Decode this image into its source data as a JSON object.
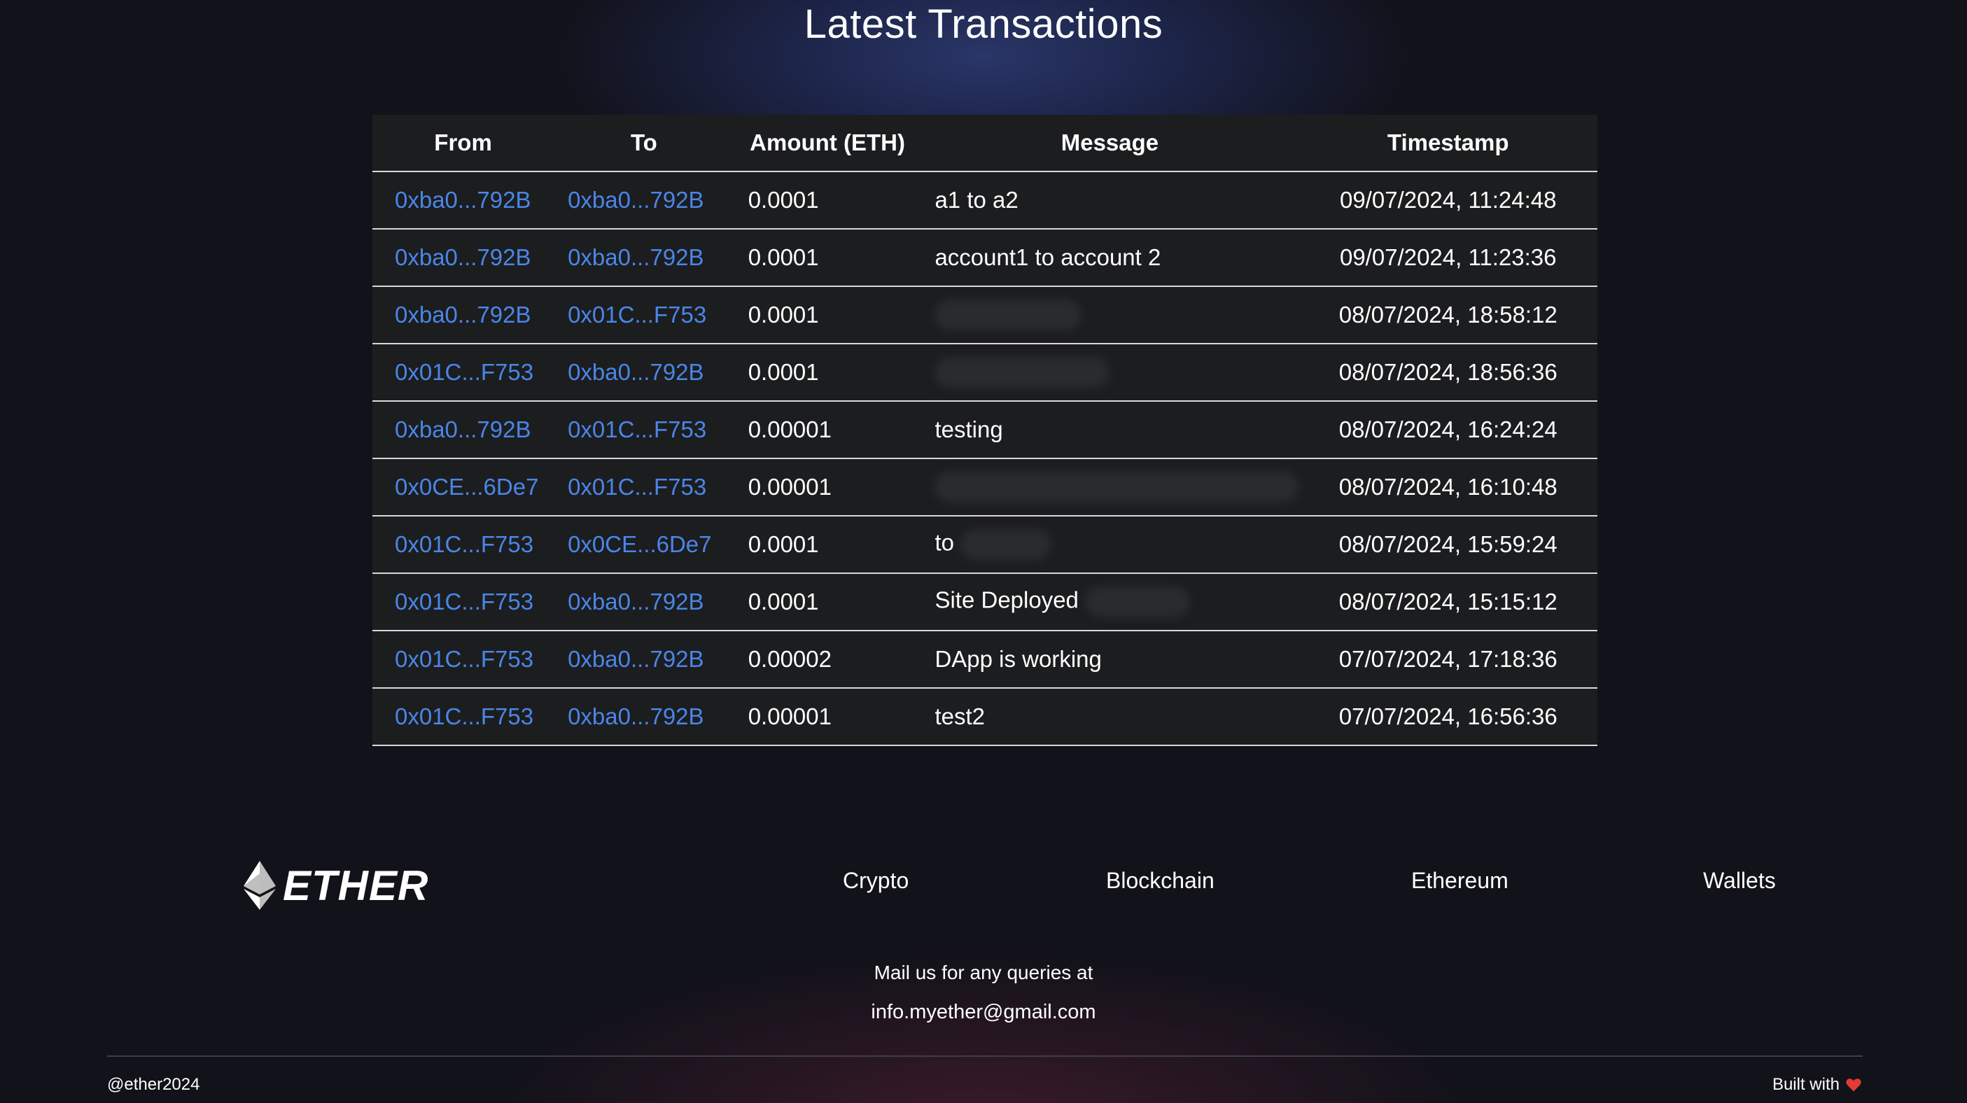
{
  "page": {
    "title": "Latest Transactions"
  },
  "table": {
    "headers": [
      "From",
      "To",
      "Amount (ETH)",
      "Message",
      "Timestamp"
    ],
    "rows": [
      {
        "from": "0xba0...792B",
        "to": "0xba0...792B",
        "amount": "0.0001",
        "message": "a1 to a2",
        "timestamp": "09/07/2024, 11:24:48"
      },
      {
        "from": "0xba0...792B",
        "to": "0xba0...792B",
        "amount": "0.0001",
        "message": "account1 to account 2",
        "timestamp": "09/07/2024, 11:23:36"
      },
      {
        "from": "0xba0...792B",
        "to": "0x01C...F753",
        "amount": "0.0001",
        "message": "",
        "timestamp": "08/07/2024, 18:58:12"
      },
      {
        "from": "0x01C...F753",
        "to": "0xba0...792B",
        "amount": "0.0001",
        "message": "",
        "timestamp": "08/07/2024, 18:56:36"
      },
      {
        "from": "0xba0...792B",
        "to": "0x01C...F753",
        "amount": "0.00001",
        "message": "testing",
        "timestamp": "08/07/2024, 16:24:24"
      },
      {
        "from": "0x0CE...6De7",
        "to": "0x01C...F753",
        "amount": "0.00001",
        "message": "",
        "timestamp": "08/07/2024, 16:10:48"
      },
      {
        "from": "0x01C...F753",
        "to": "0x0CE...6De7",
        "amount": "0.0001",
        "message": "to",
        "timestamp": "08/07/2024, 15:59:24"
      },
      {
        "from": "0x01C...F753",
        "to": "0xba0...792B",
        "amount": "0.0001",
        "message": "Site Deployed",
        "timestamp": "08/07/2024, 15:15:12"
      },
      {
        "from": "0x01C...F753",
        "to": "0xba0...792B",
        "amount": "0.00002",
        "message": "DApp is working",
        "timestamp": "07/07/2024, 17:18:36"
      },
      {
        "from": "0x01C...F753",
        "to": "0xba0...792B",
        "amount": "0.00001",
        "message": "test2",
        "timestamp": "07/07/2024, 16:56:36"
      }
    ]
  },
  "footer": {
    "logo_text": "ETHER",
    "nav": [
      {
        "label": "Crypto"
      },
      {
        "label": "Blockchain"
      },
      {
        "label": "Ethereum"
      },
      {
        "label": "Wallets"
      }
    ],
    "mail_label": "Mail us for any queries at",
    "mail_address": "info.myether@gmail.com",
    "copyright": "@ether2024",
    "built_with": "Built with"
  },
  "colors": {
    "link": "#4a86e8",
    "table_bg": "#1c1d1f",
    "page_bg": "#12121a",
    "heart": "#e53935"
  },
  "icons": {
    "logo": "ethereum-diamond-icon",
    "heart": "heart-icon"
  }
}
